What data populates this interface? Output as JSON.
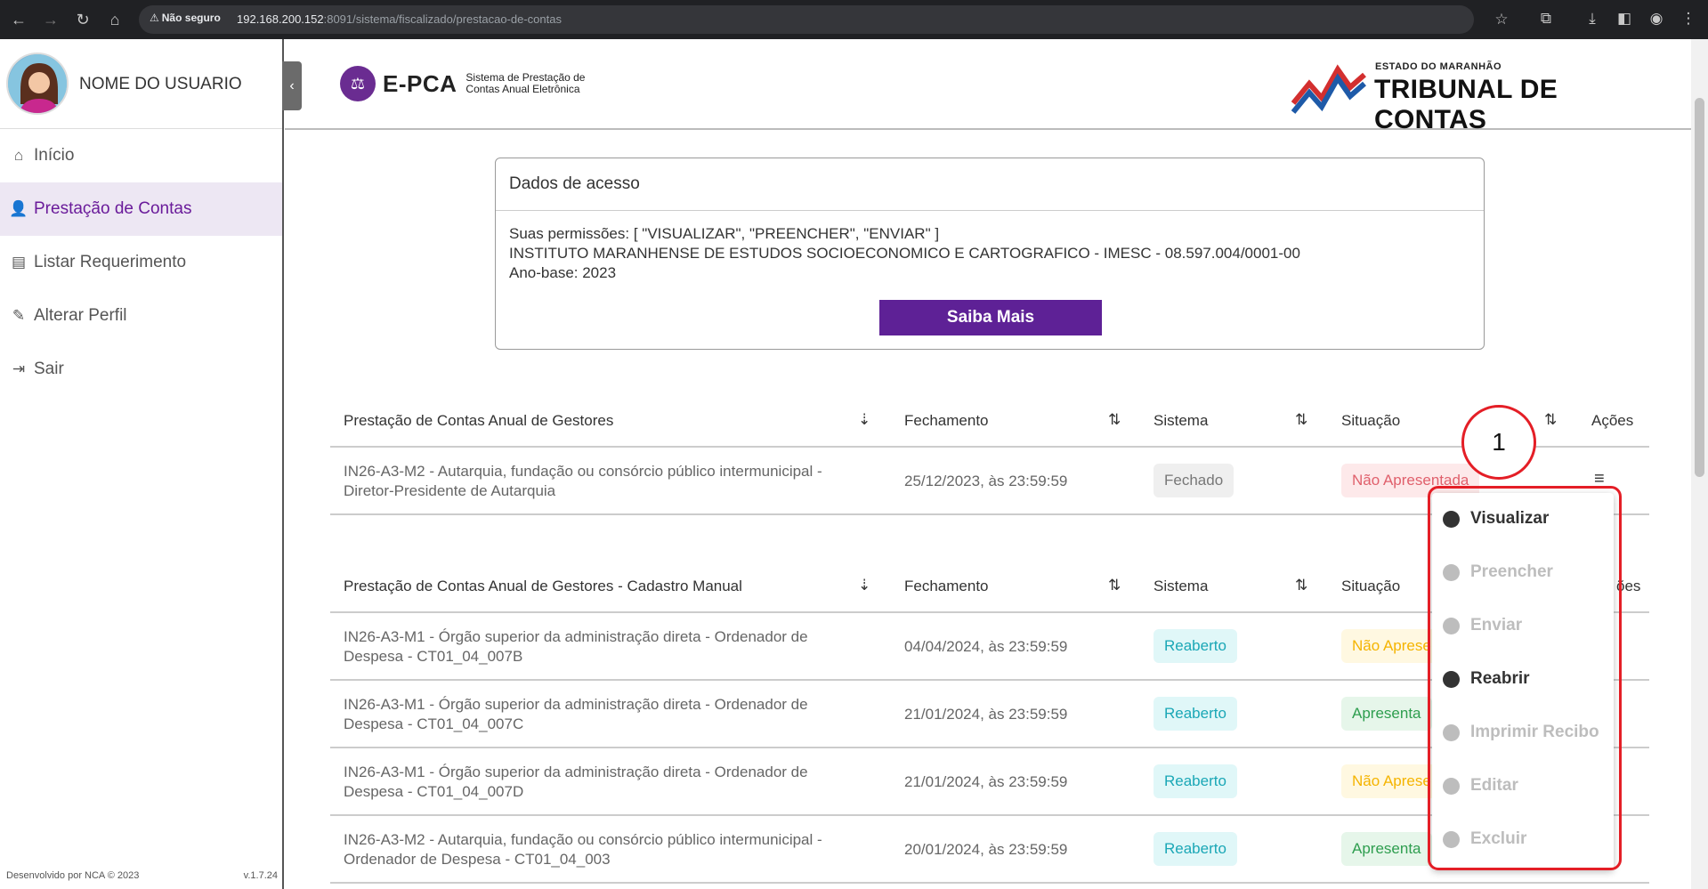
{
  "browser": {
    "not_secure": "Não seguro",
    "url_host": "192.168.200.152",
    "url_path": ":8091/sistema/fiscalizado/prestacao-de-contas"
  },
  "user": {
    "name": "NOME DO USUARIO"
  },
  "sidebar": {
    "items": [
      {
        "label": "Início",
        "icon": "home-icon"
      },
      {
        "label": "Prestação de Contas",
        "icon": "user-check-icon",
        "active": true
      },
      {
        "label": "Listar Requerimento",
        "icon": "document-icon"
      },
      {
        "label": "Alterar Perfil",
        "icon": "user-edit-icon"
      },
      {
        "label": "Sair",
        "icon": "logout-icon"
      }
    ],
    "footer_left": "Desenvolvido por NCA © 2023",
    "footer_right": "v.1.7.24"
  },
  "header": {
    "app_short": "E-PCA",
    "app_long_1": "Sistema de Prestação de",
    "app_long_2": "Contas Anual Eletrônica",
    "org_small": "ESTADO DO MARANHÃO",
    "org_big": "TRIBUNAL DE CONTAS"
  },
  "access": {
    "title": "Dados de acesso",
    "permissions": "Suas permissões: [ \"VISUALIZAR\", \"PREENCHER\", \"ENVIAR\" ]",
    "institution": "INSTITUTO MARANHENSE DE ESTUDOS SOCIOECONOMICO E CARTOGRAFICO - IMESC - 08.597.004/0001-00",
    "year": "Ano-base: 2023",
    "button": "Saiba Mais"
  },
  "table1": {
    "headers": {
      "name": "Prestação de Contas Anual de Gestores",
      "closing": "Fechamento",
      "system": "Sistema",
      "status": "Situação",
      "actions": "Ações"
    },
    "rows": [
      {
        "name_1": "IN26-A3-M2 - Autarquia, fundação ou consórcio público intermunicipal -",
        "name_2": "Diretor-Presidente de Autarquia",
        "date": "25/12/2023, às 23:59:59",
        "system": "Fechado",
        "status": "Não Apresentada"
      }
    ]
  },
  "table2": {
    "headers": {
      "name": "Prestação de Contas Anual de Gestores - Cadastro Manual",
      "closing": "Fechamento",
      "system": "Sistema",
      "status": "Situação",
      "actions": "ões"
    },
    "rows": [
      {
        "name_1": "IN26-A3-M1 - Órgão superior da administração direta - Ordenador de",
        "name_2": "Despesa - CT01_04_007B",
        "date": "04/04/2024, às 23:59:59",
        "system": "Reaberto",
        "status": "Não Aprese"
      },
      {
        "name_1": "IN26-A3-M1 - Órgão superior da administração direta - Ordenador de",
        "name_2": "Despesa - CT01_04_007C",
        "date": "21/01/2024, às 23:59:59",
        "system": "Reaberto",
        "status": "Apresenta"
      },
      {
        "name_1": "IN26-A3-M1 - Órgão superior da administração direta - Ordenador de",
        "name_2": "Despesa - CT01_04_007D",
        "date": "21/01/2024, às 23:59:59",
        "system": "Reaberto",
        "status": "Não Aprese"
      },
      {
        "name_1": "IN26-A3-M2 - Autarquia, fundação ou consórcio público intermunicipal -",
        "name_2": "Ordenador de Despesa - CT01_04_003",
        "date": "20/01/2024, às 23:59:59",
        "system": "Reaberto",
        "status": "Apresenta"
      }
    ]
  },
  "actions_menu": {
    "items": [
      {
        "label": "Visualizar",
        "enabled": true
      },
      {
        "label": "Preencher",
        "enabled": false
      },
      {
        "label": "Enviar",
        "enabled": false
      },
      {
        "label": "Reabrir",
        "enabled": true
      },
      {
        "label": "Imprimir Recibo",
        "enabled": false
      },
      {
        "label": "Editar",
        "enabled": false
      },
      {
        "label": "Excluir",
        "enabled": false
      }
    ]
  },
  "annotation": {
    "marker": "1",
    "color": "#e41e26"
  },
  "colors": {
    "brand": "#5e2196",
    "active_bg": "#ede7f3"
  }
}
